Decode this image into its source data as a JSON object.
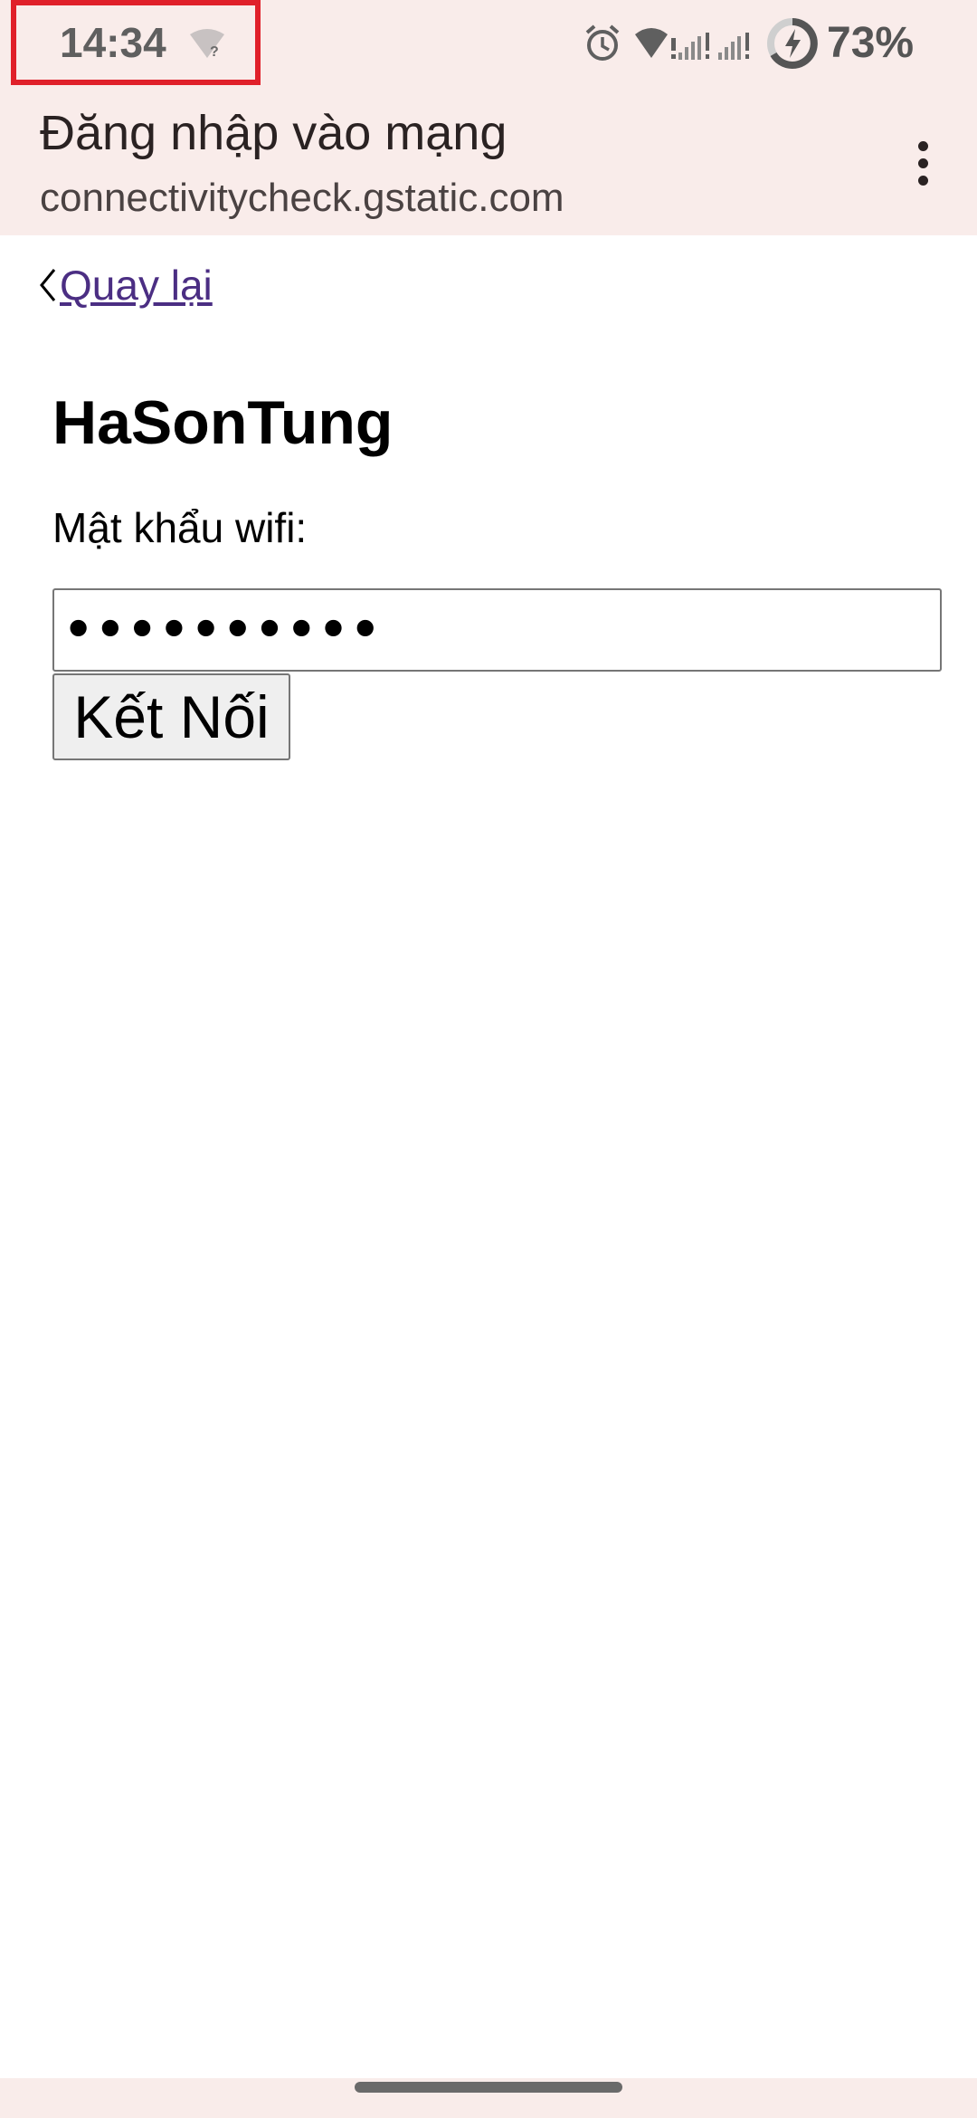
{
  "status_bar": {
    "time": "14:34",
    "battery_percent": "73%",
    "icons": [
      "wifi-question-icon",
      "alarm-icon",
      "wifi-alert-icon",
      "signal-alert-icon",
      "signal-alert-icon",
      "battery-saver-icon"
    ],
    "highlight_color": "#e0202a"
  },
  "app_bar": {
    "title": "Đăng nhập vào mạng",
    "subtitle": "connectivitycheck.gstatic.com",
    "menu_icon": "more-vert-icon",
    "background": "#f9ecea"
  },
  "page": {
    "back_label": "Quay lại",
    "network_name": "HaSonTung",
    "password_label": "Mật khẩu wifi:",
    "password_value": "••••••••••",
    "connect_label": "Kết Nối",
    "link_color": "#4b2e83"
  }
}
